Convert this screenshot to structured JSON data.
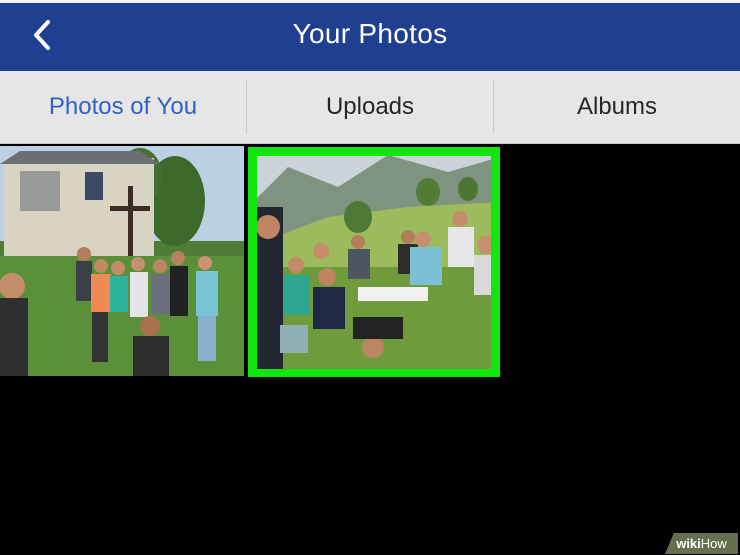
{
  "navbar": {
    "title": "Your Photos",
    "back_icon": "chevron-left-icon",
    "background": "#1f3f91"
  },
  "tabs": [
    {
      "label": "Photos of You",
      "active": true
    },
    {
      "label": "Uploads",
      "active": false
    },
    {
      "label": "Albums",
      "active": false
    }
  ],
  "colors": {
    "active_tab": "#2f62c4",
    "selection_outline": "#12e60f"
  },
  "watermark": {
    "part1": "wiki",
    "part2": "How"
  }
}
